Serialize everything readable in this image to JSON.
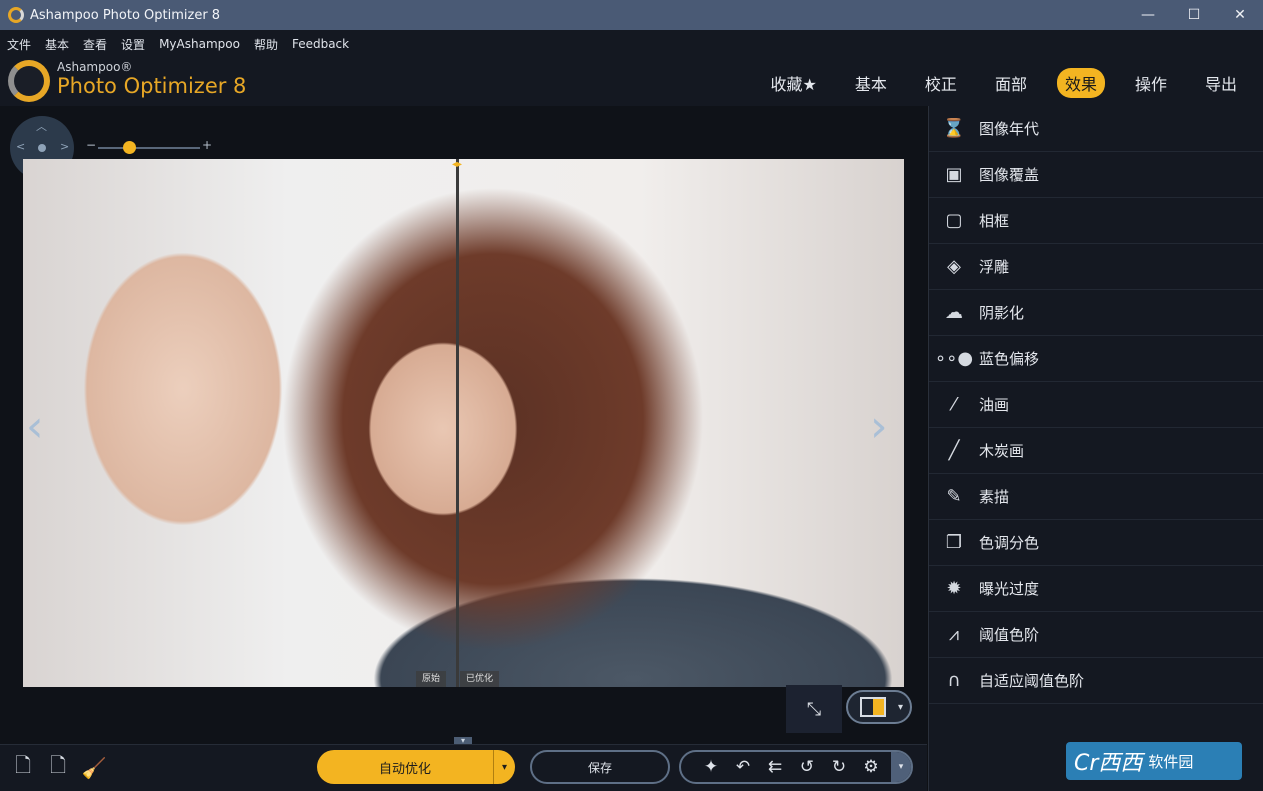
{
  "window": {
    "title": "Ashampoo Photo Optimizer 8",
    "minimize": "—",
    "maximize": "☐",
    "close": "✕"
  },
  "menu": [
    "文件",
    "基本",
    "查看",
    "设置",
    "MyAshampoo",
    "帮助",
    "Feedback"
  ],
  "logo": {
    "small": "Ashampoo®",
    "big": "Photo Optimizer 8"
  },
  "tabs": [
    {
      "label": "收藏★",
      "active": false
    },
    {
      "label": "基本",
      "active": false
    },
    {
      "label": "校正",
      "active": false
    },
    {
      "label": "面部",
      "active": false
    },
    {
      "label": "效果",
      "active": true
    },
    {
      "label": "操作",
      "active": false
    },
    {
      "label": "导出",
      "active": false
    }
  ],
  "canvas": {
    "zoom_minus": "−",
    "zoom_plus": "+",
    "zoom_level": 0.3,
    "split_handle": "◂▸",
    "label_original": "原始",
    "label_optimized": "已优化",
    "prev_arrow": "‹",
    "next_arrow": "›",
    "fit_icon": "⤡",
    "collapse": "▾"
  },
  "effects": [
    {
      "label": "图像年代",
      "icon": "hourglass-icon",
      "glyph": "⌛"
    },
    {
      "label": "图像覆盖",
      "icon": "image-overlay-icon",
      "glyph": "▣"
    },
    {
      "label": "相框",
      "icon": "frame-icon",
      "glyph": "▢"
    },
    {
      "label": "浮雕",
      "icon": "emboss-icon",
      "glyph": "◈"
    },
    {
      "label": "阴影化",
      "icon": "cloud-shadow-icon",
      "glyph": "☁"
    },
    {
      "label": "蓝色偏移",
      "icon": "dots-icon",
      "glyph": "∘∘●"
    },
    {
      "label": "油画",
      "icon": "brush-icon",
      "glyph": "⁄"
    },
    {
      "label": "木炭画",
      "icon": "charcoal-icon",
      "glyph": "╱"
    },
    {
      "label": "素描",
      "icon": "pencil-icon",
      "glyph": "✎"
    },
    {
      "label": "色调分色",
      "icon": "posterize-icon",
      "glyph": "❐"
    },
    {
      "label": "曝光过度",
      "icon": "solarize-icon",
      "glyph": "✹"
    },
    {
      "label": "阈值色阶",
      "icon": "threshold-chart-icon",
      "glyph": "⩘"
    },
    {
      "label": "自适应阈值色阶",
      "icon": "adaptive-threshold-icon",
      "glyph": "∩"
    }
  ],
  "bottom": {
    "auto_optimize": "自动优化",
    "auto_caret": "▾",
    "save": "保存",
    "tools_caret": "▾",
    "icon_add_file": "🗋",
    "icon_add_folder": "🗋",
    "icon_clean": "🧹",
    "tool_glyphs": [
      "✦",
      "↶",
      "⇇",
      "↺",
      "↻",
      "⚙"
    ]
  },
  "watermark": {
    "logo": "Cr西西",
    "text": "软件园"
  }
}
